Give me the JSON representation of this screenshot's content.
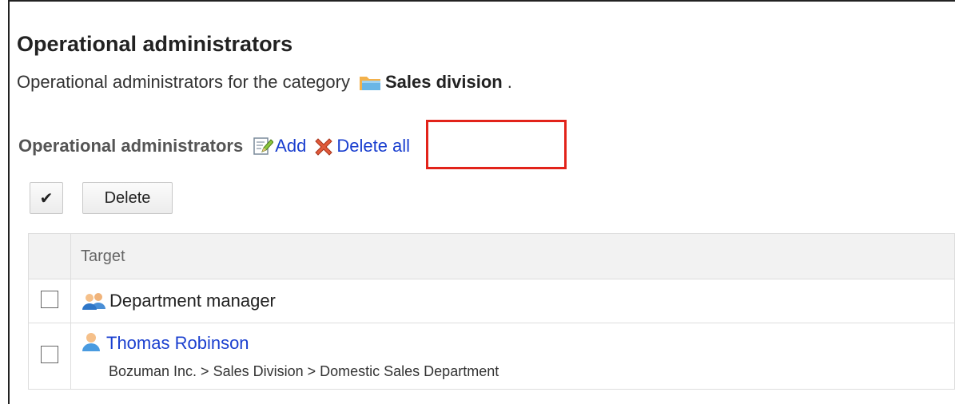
{
  "page": {
    "title": "Operational administrators",
    "description_prefix": "Operational administrators for the category",
    "category_name": "Sales division",
    "description_suffix": ".",
    "folder_icon": "folder-icon"
  },
  "section": {
    "title": "Operational administrators",
    "add_label": "Add",
    "add_icon": "edit-icon",
    "delete_all_label": "Delete all",
    "delete_all_icon": "delete-x-icon",
    "highlight_color": "#e2231a"
  },
  "actions": {
    "check_all_label": "✔",
    "delete_label": "Delete"
  },
  "table": {
    "header": "Target",
    "rows": [
      {
        "icon": "group-icon",
        "name": "Department manager"
      },
      {
        "icon": "user-icon",
        "name": "Thomas Robinson",
        "path": "Bozuman Inc. > Sales Division > Domestic Sales Department"
      }
    ]
  },
  "colors": {
    "link": "#1a3fcf",
    "header_bg": "#f2f2f2",
    "border": "#dddddd"
  }
}
